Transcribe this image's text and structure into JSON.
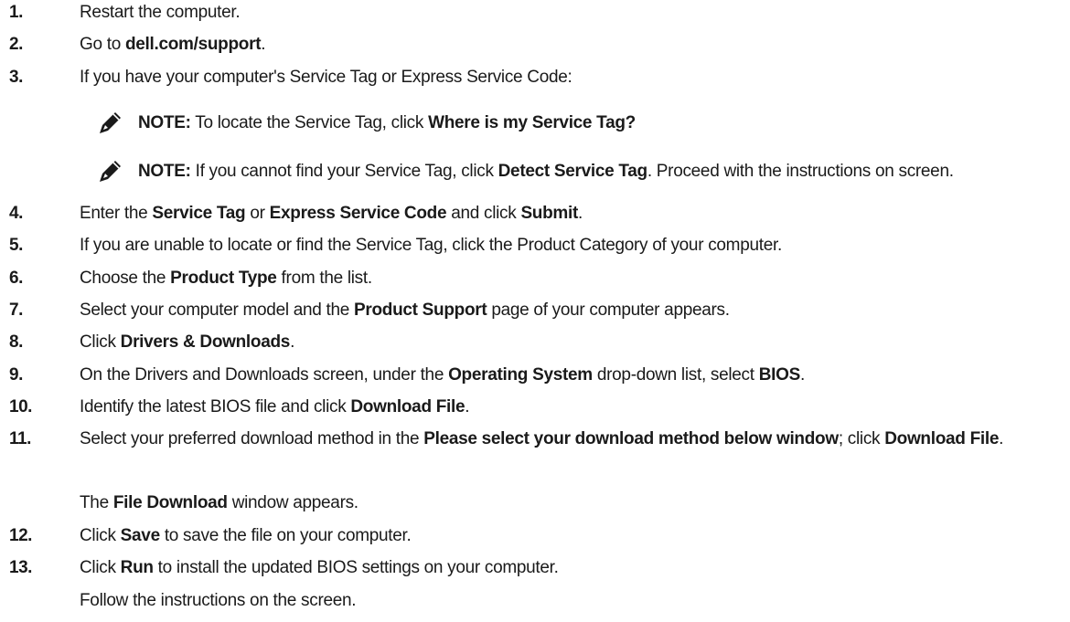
{
  "steps": [
    {
      "num": "1.",
      "parts": [
        {
          "t": "Restart the computer."
        }
      ]
    },
    {
      "num": "2.",
      "parts": [
        {
          "t": "Go to "
        },
        {
          "t": "dell.com/support",
          "b": true
        },
        {
          "t": "."
        }
      ]
    },
    {
      "num": "3.",
      "parts": [
        {
          "t": "If you have your computer's Service Tag or Express Service Code:"
        }
      ]
    },
    {
      "num": "4.",
      "parts": [
        {
          "t": "Enter the "
        },
        {
          "t": "Service Tag",
          "b": true
        },
        {
          "t": " or "
        },
        {
          "t": "Express Service Code",
          "b": true
        },
        {
          "t": " and click "
        },
        {
          "t": "Submit",
          "b": true
        },
        {
          "t": "."
        }
      ]
    },
    {
      "num": "5.",
      "parts": [
        {
          "t": "If you are unable to locate or find the Service Tag, click the Product Category of your computer."
        }
      ]
    },
    {
      "num": "6.",
      "parts": [
        {
          "t": "Choose the "
        },
        {
          "t": "Product Type",
          "b": true
        },
        {
          "t": " from the list."
        }
      ]
    },
    {
      "num": "7.",
      "parts": [
        {
          "t": "Select your computer model and the "
        },
        {
          "t": "Product Support",
          "b": true
        },
        {
          "t": " page of your computer appears."
        }
      ]
    },
    {
      "num": "8.",
      "parts": [
        {
          "t": "Click "
        },
        {
          "t": "Drivers & Downloads",
          "b": true
        },
        {
          "t": "."
        }
      ]
    },
    {
      "num": "9.",
      "parts": [
        {
          "t": "On the Drivers and Downloads screen, under the "
        },
        {
          "t": "Operating System",
          "b": true
        },
        {
          "t": " drop-down list, select "
        },
        {
          "t": "BIOS",
          "b": true
        },
        {
          "t": "."
        }
      ]
    },
    {
      "num": "10.",
      "parts": [
        {
          "t": "Identify the latest BIOS file and click "
        },
        {
          "t": "Download File",
          "b": true
        },
        {
          "t": "."
        }
      ]
    },
    {
      "num": "11.",
      "parts": [
        {
          "t": "Select your preferred download method in the "
        },
        {
          "t": "Please select your download method below window",
          "b": true
        },
        {
          "t": "; click "
        },
        {
          "t": "Download File",
          "b": true
        },
        {
          "t": "."
        }
      ]
    },
    {
      "num": "12.",
      "parts": [
        {
          "t": "Click "
        },
        {
          "t": "Save",
          "b": true
        },
        {
          "t": " to save the file on your computer."
        }
      ]
    },
    {
      "num": "13.",
      "parts": [
        {
          "t": "Click "
        },
        {
          "t": "Run",
          "b": true
        },
        {
          "t": " to install the updated BIOS settings on your computer."
        }
      ]
    }
  ],
  "notes": [
    {
      "parts": [
        {
          "t": "NOTE:",
          "b": true
        },
        {
          "t": " To locate the Service Tag, click "
        },
        {
          "t": "Where is my Service Tag?",
          "b": true
        }
      ]
    },
    {
      "parts": [
        {
          "t": "NOTE:",
          "b": true
        },
        {
          "t": " If you cannot find your Service Tag, click "
        },
        {
          "t": "Detect Service Tag",
          "b": true
        },
        {
          "t": ". Proceed with the instructions on screen."
        }
      ]
    }
  ],
  "followups": [
    {
      "parts": [
        {
          "t": "The "
        },
        {
          "t": "File Download",
          "b": true
        },
        {
          "t": " window appears."
        }
      ]
    },
    {
      "parts": [
        {
          "t": "Follow the instructions on the screen."
        }
      ]
    }
  ],
  "icons": {
    "note": "note-pencil-icon"
  }
}
